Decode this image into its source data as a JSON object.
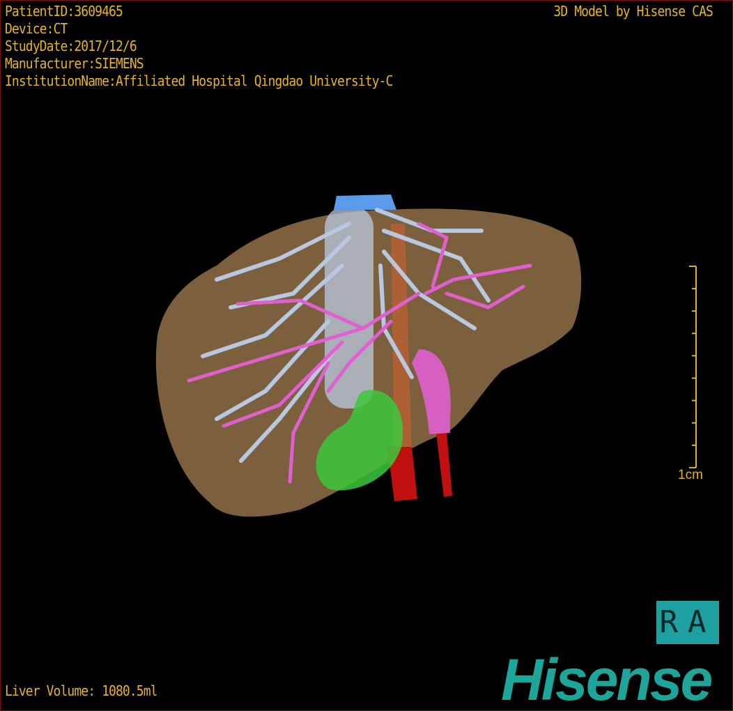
{
  "overlay": {
    "patient_id": "PatientID:3609465",
    "device": "Device:CT",
    "study_date": "StudyDate:2017/12/6",
    "manufacturer": "Manufacturer:SIEMENS",
    "institution": "InstitutionName:Affiliated Hospital Qingdao University-C",
    "credit": "3D Model by Hisense CAS",
    "liver_volume": "Liver Volume: 1080.5ml",
    "scale_label": "1cm",
    "orientation": "RA",
    "logo": "Hisense"
  },
  "colors": {
    "text": "#e6b422",
    "liver": "#8a6a44",
    "hepatic_vein": "#b8c8e0",
    "portal_vein": "#e060d0",
    "ivc": "#5a9ae8",
    "artery": "#c01010",
    "gallbladder": "#3cc83c",
    "brand": "#1ea59a"
  }
}
